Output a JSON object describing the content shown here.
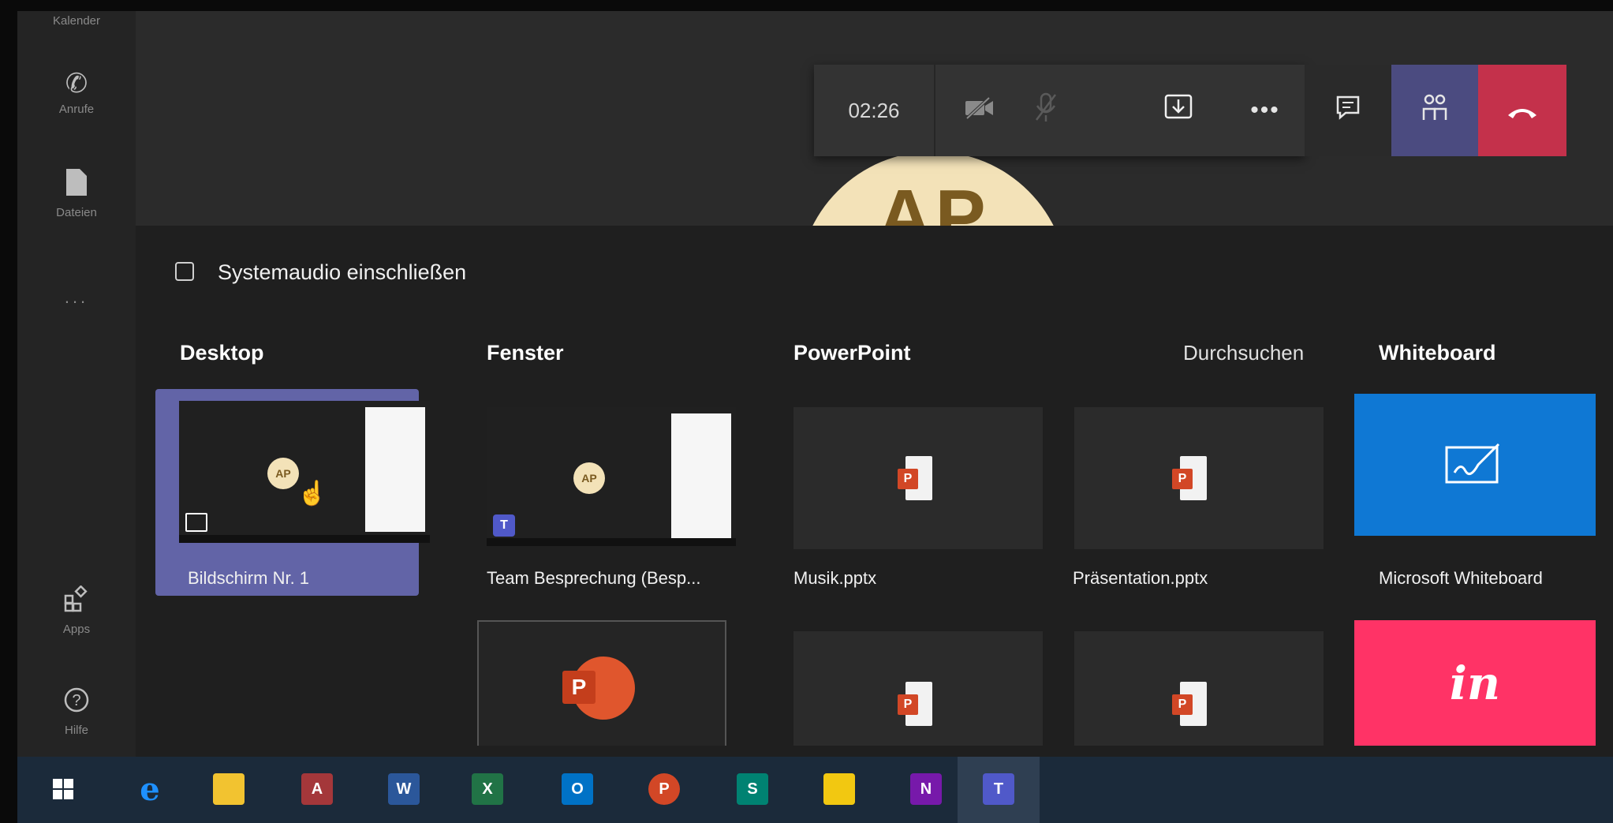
{
  "rail": {
    "items": [
      {
        "label": "Kalender"
      },
      {
        "label": "Anrufe"
      },
      {
        "label": "Dateien"
      },
      {
        "label": "..."
      },
      {
        "label": "Apps"
      },
      {
        "label": "Hilfe"
      }
    ]
  },
  "stage": {
    "avatar_initials": "AP"
  },
  "callbar": {
    "timer": "02:26",
    "buttons": [
      "camera-off",
      "mic-off",
      "share-tray",
      "more",
      "chat",
      "participants",
      "hang-up"
    ]
  },
  "share": {
    "system_audio_label": "Systemaudio einschließen",
    "system_audio_checked": false,
    "sections": {
      "desktop": "Desktop",
      "window": "Fenster",
      "powerpoint": "PowerPoint",
      "browse": "Durchsuchen",
      "whiteboard": "Whiteboard"
    },
    "desktop_items": [
      {
        "label": "Bildschirm Nr. 1",
        "thumb_initials": "AP",
        "selected": true
      }
    ],
    "window_items": [
      {
        "label": "Team Besprechung (Besp...",
        "thumb_initials": "AP"
      },
      {
        "label": ""
      }
    ],
    "powerpoint_items": [
      {
        "label": "Musik.pptx"
      },
      {
        "label": "Präsentation.pptx"
      },
      {
        "label": ""
      },
      {
        "label": ""
      }
    ],
    "whiteboard_items": [
      {
        "label": "Microsoft Whiteboard"
      },
      {
        "label": "",
        "logo_text": "in"
      }
    ]
  },
  "taskbar": {
    "apps": [
      "windows-start",
      "edge",
      "file-explorer",
      "access",
      "word",
      "excel",
      "outlook",
      "powerpoint",
      "sway",
      "power-bi",
      "onenote",
      "teams"
    ],
    "active": "teams",
    "labels": {
      "access": "A",
      "word": "W",
      "excel": "X",
      "outlook": "O",
      "powerpoint": "P",
      "sway": "S",
      "onenote": "N",
      "teams": "T"
    }
  },
  "colors": {
    "accent": "#6264a7",
    "hangup": "#c4314b",
    "whiteboard": "#0f78d4",
    "invision": "#ff3366",
    "ppt": "#d24726"
  }
}
